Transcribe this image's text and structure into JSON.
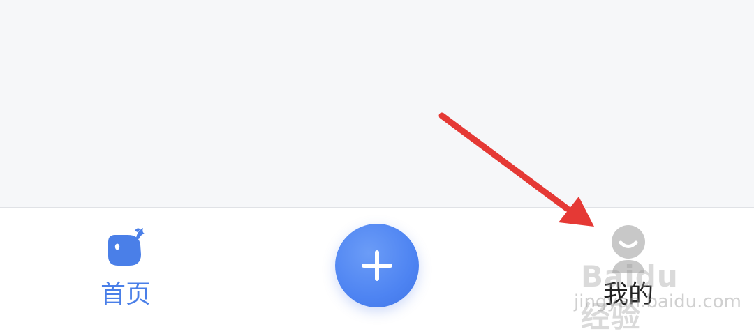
{
  "tabbar": {
    "home": {
      "label": "首页",
      "icon": "whale-icon",
      "active": true,
      "color": "#4a7fe8"
    },
    "add": {
      "icon": "plus-icon",
      "color": "#4e84f2"
    },
    "mine": {
      "label": "我的",
      "icon": "avatar-icon",
      "color": "#222222"
    }
  },
  "annotation": {
    "arrow_color": "#e53935"
  },
  "watermark": {
    "brand": "Baidu 经验",
    "domain": "jingyan.baidu.com"
  }
}
